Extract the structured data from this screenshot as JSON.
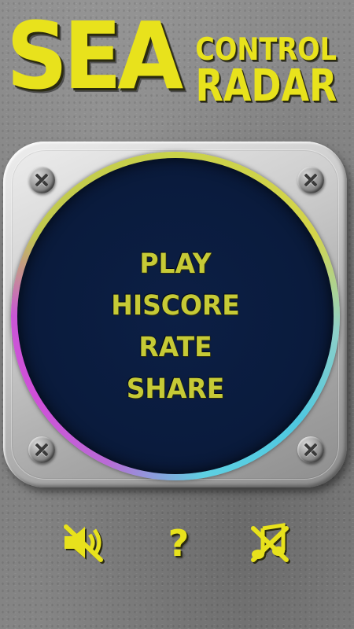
{
  "title": {
    "big": "SEA",
    "line1": "CONTROL",
    "line2": "RADAR"
  },
  "menu": {
    "items": [
      {
        "label": "PLAY"
      },
      {
        "label": "HISCORE"
      },
      {
        "label": "RATE"
      },
      {
        "label": "SHARE"
      }
    ]
  },
  "bottom_bar": {
    "help_label": "?",
    "icons": [
      "sound-muted-icon",
      "help-icon",
      "music-muted-icon"
    ]
  },
  "colors": {
    "accent_yellow": "#e8e21c",
    "menu_text": "#c6ca36",
    "radar_screen": "#0a1b3d",
    "ring_yellow": "#c9d24a",
    "ring_cyan": "#4fc8e0",
    "ring_magenta": "#d04fd8",
    "background_gray": "#808080"
  }
}
